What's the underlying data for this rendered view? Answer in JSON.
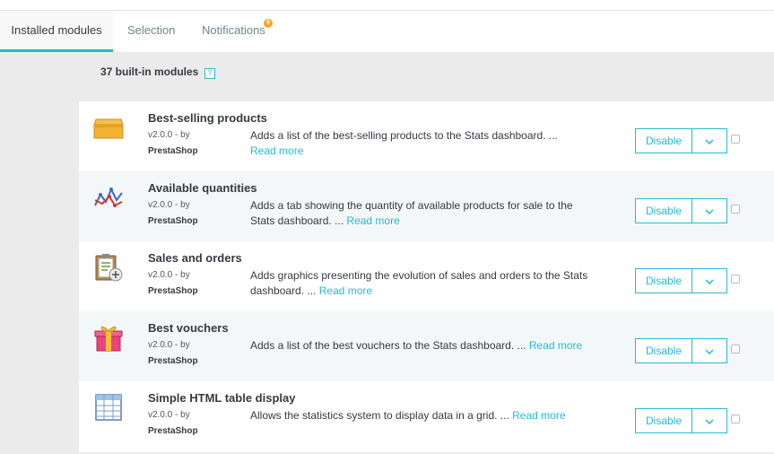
{
  "tabs": {
    "installed": "Installed modules",
    "selection": "Selection",
    "notifications": "Notifications",
    "notifications_count": "9"
  },
  "modules_count_label": "37 built-in modules",
  "help_icon_symbol": "?",
  "colors": {
    "accent": "#25b9d7",
    "badge": "#f5a623",
    "background": "#ebebeb"
  },
  "modules": [
    {
      "icon": "box-icon",
      "name": "Best-selling products",
      "version": "v2.0.0 - by",
      "author": "PrestaShop",
      "description": "Adds a list of the best-selling products to the Stats dashboard. ...",
      "read_more": "Read more",
      "action": "Disable"
    },
    {
      "icon": "line-chart-icon",
      "name": "Available quantities",
      "version": "v2.0.0 - by",
      "author": "PrestaShop",
      "description": "Adds a tab showing the quantity of available products for sale to the Stats dashboard. ...",
      "read_more": "Read more",
      "action": "Disable"
    },
    {
      "icon": "clipboard-icon",
      "name": "Sales and orders",
      "version": "v2.0.0 - by",
      "author": "PrestaShop",
      "description": "Adds graphics presenting the evolution of sales and orders to the Stats dashboard. ...",
      "read_more": "Read more",
      "action": "Disable"
    },
    {
      "icon": "gift-icon",
      "name": "Best vouchers",
      "version": "v2.0.0 - by",
      "author": "PrestaShop",
      "description": "Adds a list of the best vouchers to the Stats dashboard. ...",
      "read_more": "Read more",
      "action": "Disable"
    },
    {
      "icon": "table-icon",
      "name": "Simple HTML table display",
      "version": "v2.0.0 - by",
      "author": "PrestaShop",
      "description": "Allows the statistics system to display data in a grid. ...",
      "read_more": "Read more",
      "action": "Disable"
    }
  ]
}
